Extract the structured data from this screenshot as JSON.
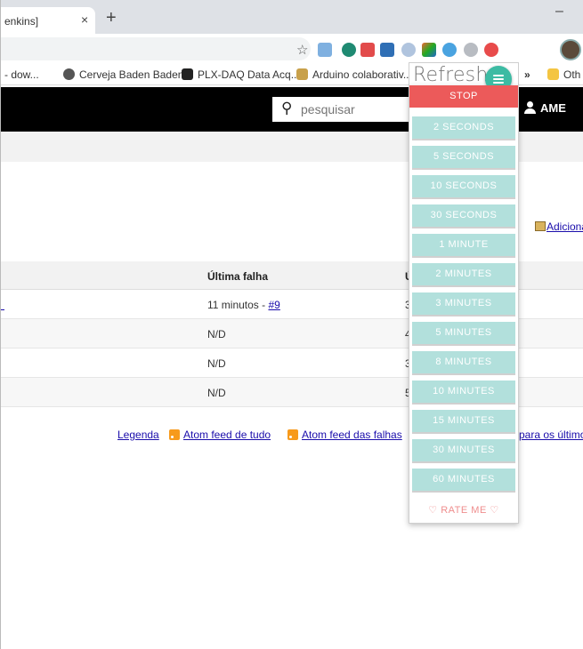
{
  "browser": {
    "tab_title": "enkins]",
    "tab_close": "×",
    "new_tab": "+",
    "minimize": "–",
    "star": "☆"
  },
  "bookmarks": [
    {
      "label": "- dow...",
      "icon": "none"
    },
    {
      "label": "Cerveja Baden Baden",
      "icon": "globe-icon"
    },
    {
      "label": "PLX-DAQ Data Acq...",
      "icon": "plx-daq-icon"
    },
    {
      "label": "Arduino colaborativ...",
      "icon": "arduino-icon"
    },
    {
      "label": "»",
      "icon": "none"
    },
    {
      "label": "Oth",
      "icon": "folder-icon"
    }
  ],
  "header": {
    "search_placeholder": "pesquisar",
    "user": "AME"
  },
  "description_link": "Adiciona",
  "table": {
    "columns": [
      "Última falha",
      "Ú"
    ],
    "rows": [
      {
        "last_failure": "11 minutos - ",
        "build_link": "#9",
        "next": "3"
      },
      {
        "last_failure": "N/D",
        "build_link": "",
        "next": "4"
      },
      {
        "last_failure": "N/D",
        "build_link": "",
        "next": "3"
      },
      {
        "last_failure": "N/D",
        "build_link": "",
        "next": "5"
      }
    ]
  },
  "footer": {
    "legend": "Legenda",
    "atom_all": "Atom feed de tudo",
    "atom_failures": "Atom feed das falhas",
    "latest": "para os últimos"
  },
  "refresh_popup": {
    "title": "Refresh",
    "stop": "STOP",
    "options": [
      "2 SECONDS",
      "5 SECONDS",
      "10 SECONDS",
      "30 SECONDS",
      "1 MINUTE",
      "2 MINUTES",
      "3 MINUTES",
      "5 MINUTES",
      "8 MINUTES",
      "10 MINUTES",
      "15 MINUTES",
      "30 MINUTES",
      "60 MINUTES"
    ],
    "rate_me": "RATE ME",
    "colors": {
      "stop": "#ec5a5a",
      "option": "#b2e0dc",
      "accent": "#3cbba3",
      "rate": "#ef8d8d"
    }
  }
}
